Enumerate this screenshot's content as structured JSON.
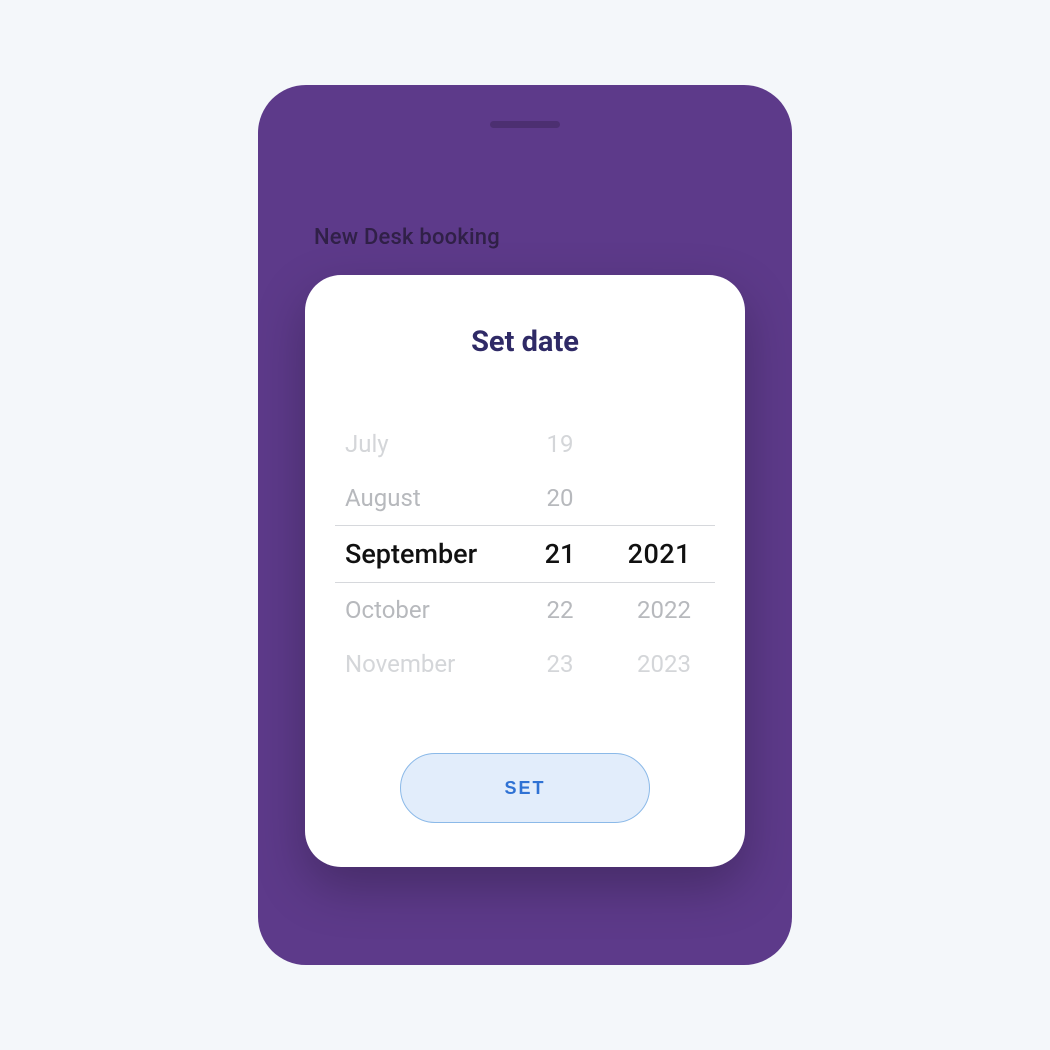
{
  "background": {
    "page_heading": "New Desk booking"
  },
  "modal": {
    "title": "Set date",
    "set_button_label": "SET"
  },
  "picker": {
    "rows": [
      {
        "month": "July",
        "day": "19",
        "year": ""
      },
      {
        "month": "August",
        "day": "20",
        "year": ""
      },
      {
        "month": "September",
        "day": "21",
        "year": "2021"
      },
      {
        "month": "October",
        "day": "22",
        "year": "2022"
      },
      {
        "month": "November",
        "day": "23",
        "year": "2023"
      }
    ],
    "selected_index": 2
  }
}
